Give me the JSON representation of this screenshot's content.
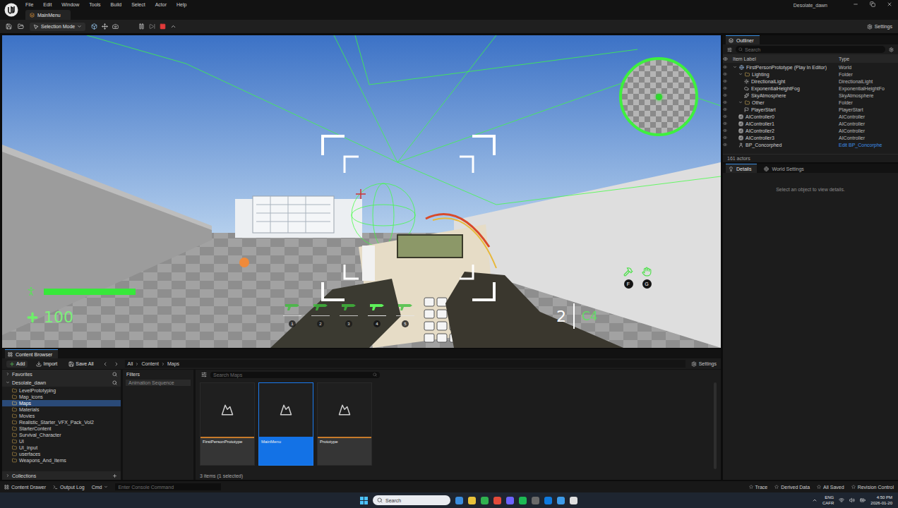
{
  "app": {
    "title": "Desolate_dawn",
    "menu": [
      "File",
      "Edit",
      "Window",
      "Tools",
      "Build",
      "Select",
      "Actor",
      "Help"
    ],
    "tabs": [
      {
        "label": "MainMenu",
        "selected": true
      }
    ]
  },
  "toolbar": {
    "mode": "Selection Mode",
    "settings": "Settings"
  },
  "hud": {
    "health": {
      "level": 1,
      "value": "100"
    },
    "slots": [
      {
        "number": "1",
        "selected": false
      },
      {
        "number": "2",
        "selected": false
      },
      {
        "number": "3",
        "selected": false
      },
      {
        "number": "4",
        "selected": true
      },
      {
        "number": "5",
        "selected": false
      }
    ],
    "ammo": "2",
    "weapon": "C4",
    "keys": [
      "F",
      "G"
    ]
  },
  "outliner": {
    "title": "Outliner",
    "search": {
      "placeholder": "Search"
    },
    "columns": [
      "Item Label",
      "Type"
    ],
    "rows": [
      {
        "label": "FirstPersonPrototype (Play In Editor)",
        "type": "World",
        "depth": 0,
        "kind": "world",
        "expanded": true
      },
      {
        "label": "Lighting",
        "type": "Folder",
        "depth": 1,
        "kind": "folder",
        "expanded": true
      },
      {
        "label": "DirectionalLight",
        "type": "DirectionalLight",
        "depth": 2,
        "kind": "light",
        "expanded": false
      },
      {
        "label": "ExponentialHeightFog",
        "type": "ExponentialHeightFo",
        "depth": 2,
        "kind": "fog",
        "expanded": false
      },
      {
        "label": "SkyAtmosphere",
        "type": "SkyAtmosphere",
        "depth": 2,
        "kind": "sky",
        "expanded": false
      },
      {
        "label": "Other",
        "type": "Folder",
        "depth": 1,
        "kind": "folder",
        "expanded": true
      },
      {
        "label": "PlayerStart",
        "type": "PlayerStart",
        "depth": 2,
        "kind": "start",
        "expanded": false
      },
      {
        "label": "AIController0",
        "type": "AIController",
        "depth": 1,
        "kind": "controller",
        "expanded": false
      },
      {
        "label": "AIController1",
        "type": "AIController",
        "depth": 1,
        "kind": "controller",
        "expanded": false
      },
      {
        "label": "AIController2",
        "type": "AIController",
        "depth": 1,
        "kind": "controller",
        "expanded": false
      },
      {
        "label": "AIController3",
        "type": "AIController",
        "depth": 1,
        "kind": "controller",
        "expanded": false
      },
      {
        "label": "BP_Concorphed",
        "type": "Edit BP_Concorphe",
        "depth": 1,
        "kind": "blueprint",
        "expanded": false
      }
    ],
    "count": "161 actors"
  },
  "details": {
    "tabs": [
      {
        "label": "Details",
        "selected": true
      },
      {
        "label": "World Settings",
        "selected": false
      }
    ],
    "empty": "Select an object to view details."
  },
  "content_browser": {
    "title": "Content Browser",
    "actions": [
      "Add",
      "Import",
      "Save All"
    ],
    "path": [
      "All",
      "Content",
      "Maps"
    ],
    "settings": "Settings",
    "tree": {
      "favorites": "Favorites",
      "root": "Desolate_dawn",
      "items": [
        {
          "label": "LevelPrototyping",
          "selected": false
        },
        {
          "label": "Map_icons",
          "selected": false
        },
        {
          "label": "Maps",
          "selected": true
        },
        {
          "label": "Materials",
          "selected": false
        },
        {
          "label": "Movies",
          "selected": false
        },
        {
          "label": "Realistic_Starter_VFX_Pack_Vol2",
          "selected": false
        },
        {
          "label": "StarterContent",
          "selected": false
        },
        {
          "label": "Survival_Character",
          "selected": false
        },
        {
          "label": "UI",
          "selected": false
        },
        {
          "label": "UI_input",
          "selected": false
        },
        {
          "label": "userfaces",
          "selected": false
        },
        {
          "label": "Weapons_And_Items",
          "selected": false
        }
      ],
      "collections": "Collections"
    },
    "filters": {
      "title": "Filters",
      "items": [
        "Animation Sequence"
      ]
    },
    "search": {
      "placeholder": "Search Maps"
    },
    "assets": [
      {
        "name": "FirstPersonPrototype",
        "selected": false
      },
      {
        "name": "MainMenu",
        "selected": true
      },
      {
        "name": "Prototype",
        "selected": false
      }
    ],
    "status": "3 items (1 selected)"
  },
  "status_bar": {
    "left": [
      "Content Drawer",
      "Output Log"
    ],
    "cmd": "Cmd",
    "console_placeholder": "Enter Console Command",
    "right": [
      "Trace",
      "Derived Data",
      "All Saved",
      "Revision Control"
    ]
  },
  "taskbar": {
    "search": "Search",
    "lang": [
      "ENG",
      "CAFR"
    ],
    "time": "4:50 PM",
    "date": "2026-01-20"
  }
}
